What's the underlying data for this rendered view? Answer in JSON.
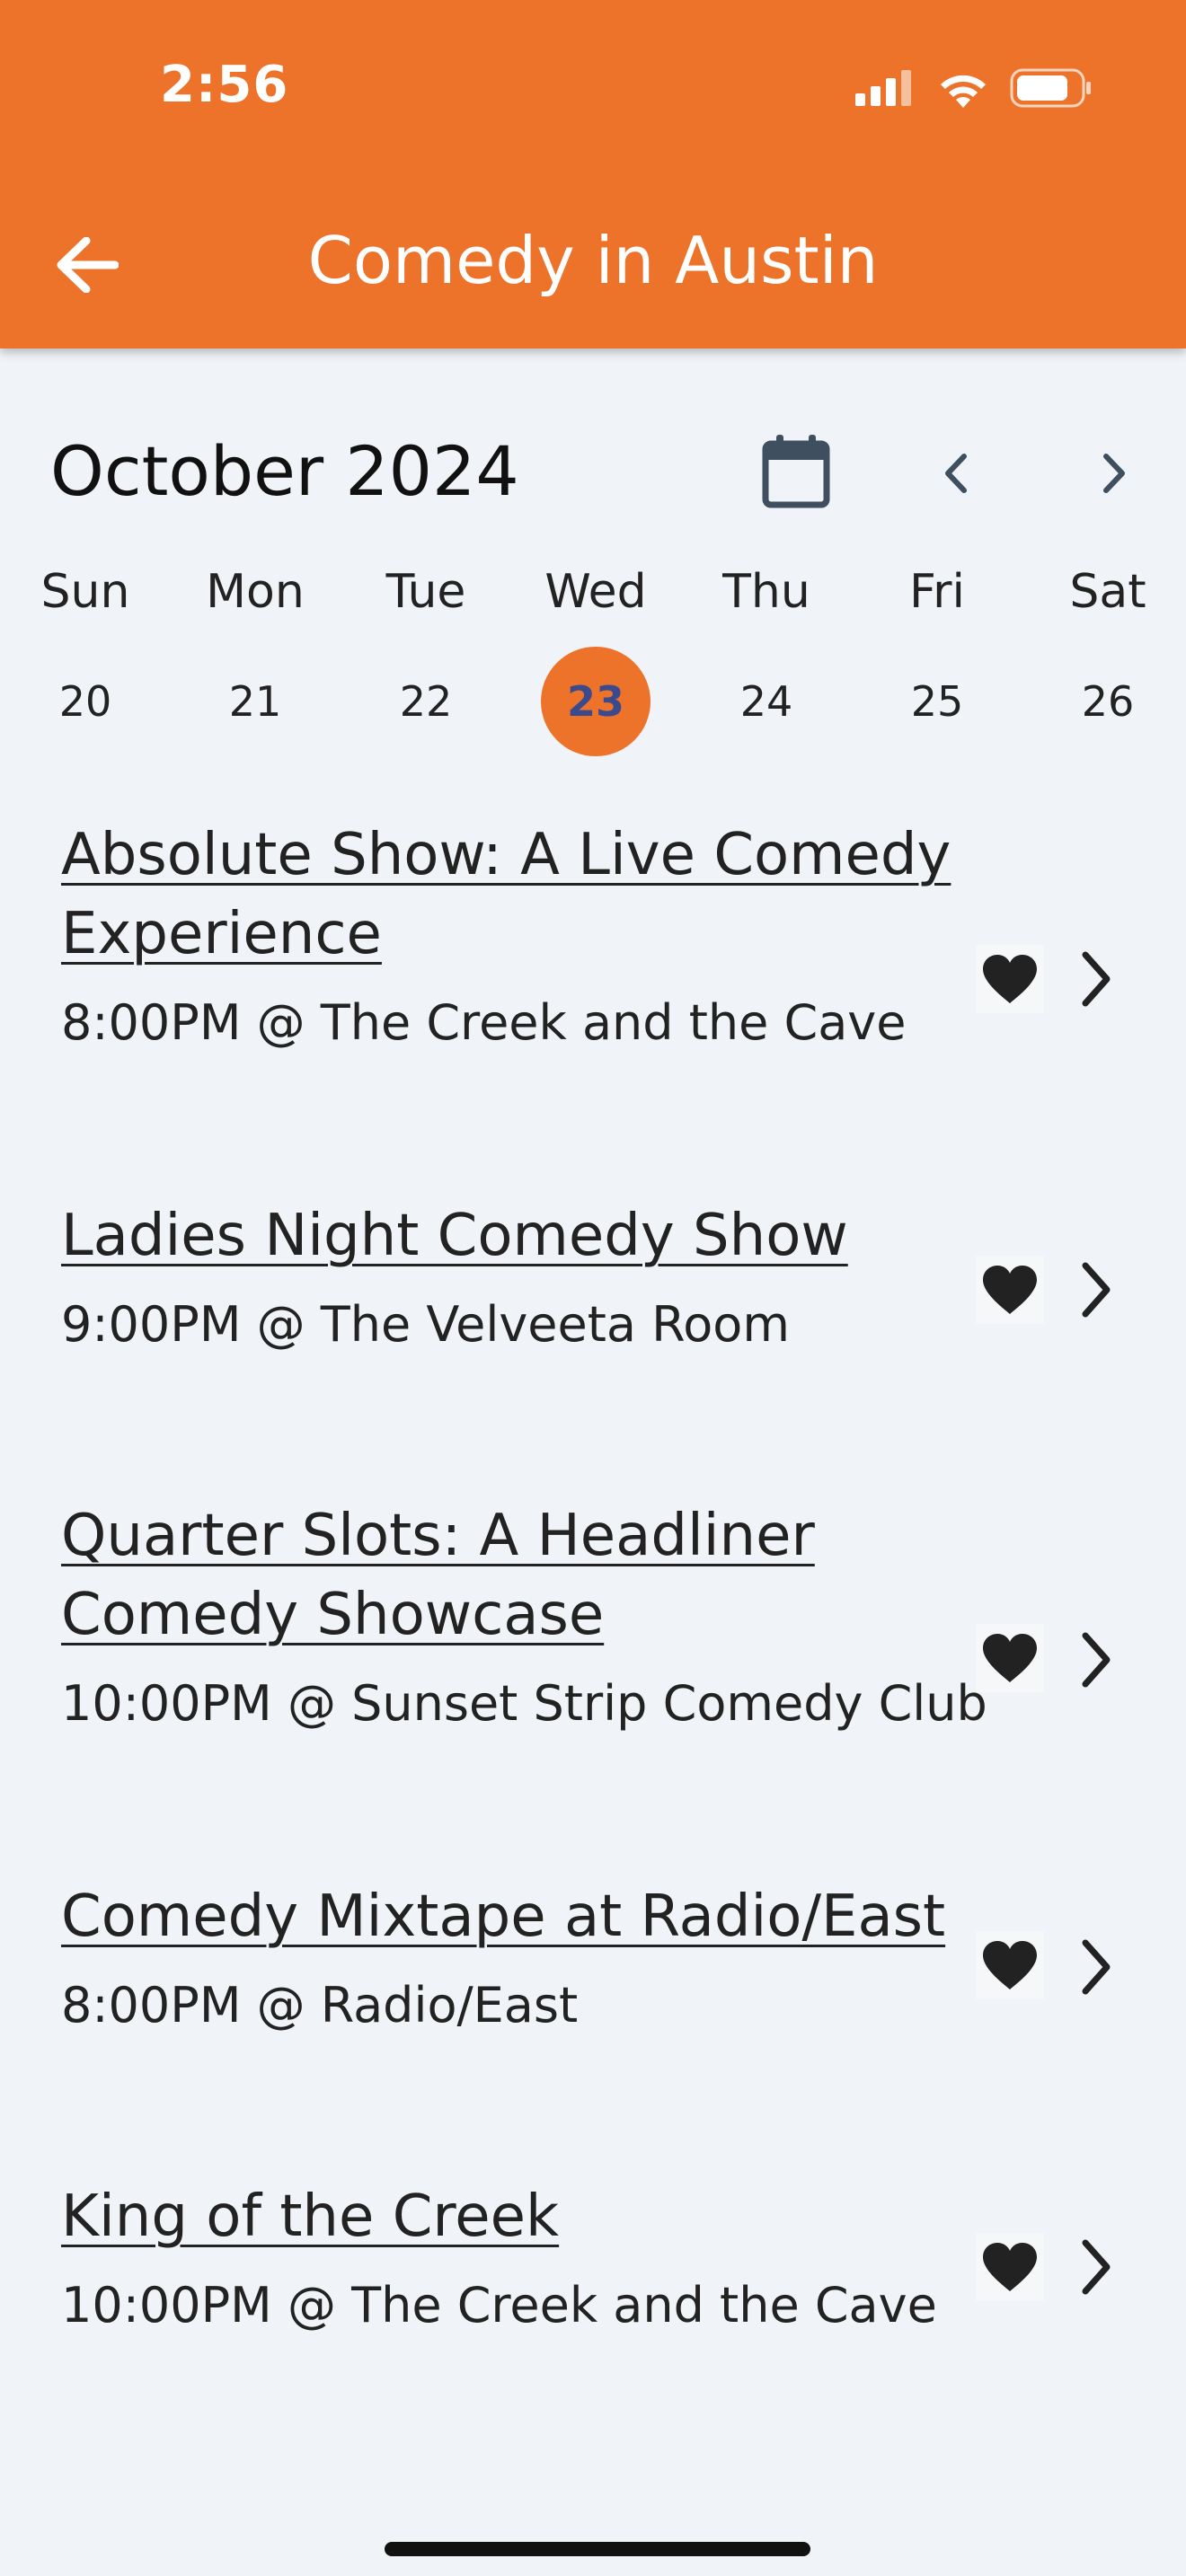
{
  "status_bar": {
    "time": "2:56"
  },
  "header": {
    "title": "Comedy in Austin",
    "back_icon": "arrow-left-icon",
    "color": "#ec7329"
  },
  "calendar": {
    "month_label": "October 2024",
    "days": [
      {
        "name": "Sun",
        "num": "20"
      },
      {
        "name": "Mon",
        "num": "21"
      },
      {
        "name": "Tue",
        "num": "22"
      },
      {
        "name": "Wed",
        "num": "23",
        "selected": true
      },
      {
        "name": "Thu",
        "num": "24"
      },
      {
        "name": "Fri",
        "num": "25"
      },
      {
        "name": "Sat",
        "num": "26"
      }
    ]
  },
  "events": [
    {
      "title_line1": "Absolute Show: A Live Comedy",
      "title_line2": "Experience",
      "subtitle": "8:00PM @ The Creek and the Cave"
    },
    {
      "title_line1": "Ladies Night Comedy Show",
      "subtitle": "9:00PM @ The Velveeta Room"
    },
    {
      "title_line1": "Quarter Slots: A Headliner",
      "title_line2": "Comedy Showcase",
      "subtitle": "10:00PM @ Sunset Strip Comedy Club"
    },
    {
      "title_line1": "Comedy Mixtape at Radio/East",
      "subtitle": "8:00PM @ Radio/East"
    },
    {
      "title_line1": "King of the Creek",
      "subtitle": "10:00PM @ The Creek and the Cave"
    }
  ]
}
